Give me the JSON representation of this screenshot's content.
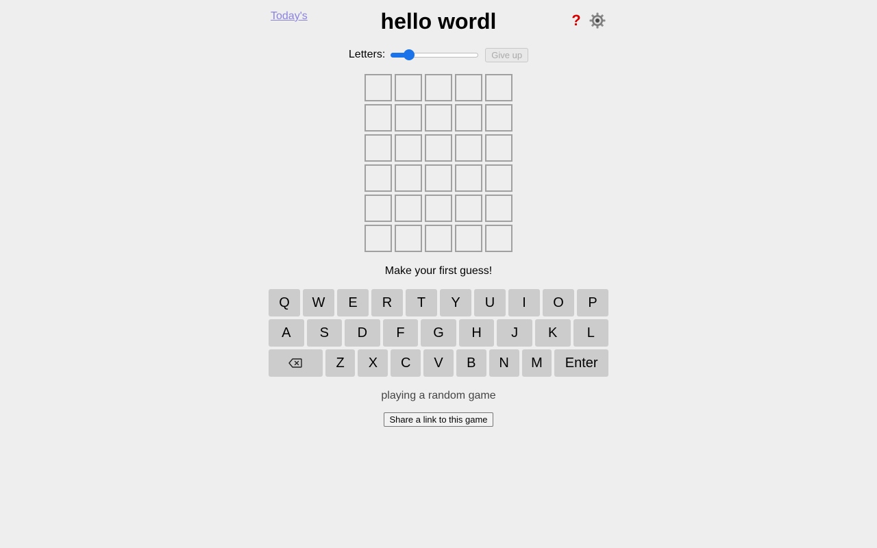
{
  "header": {
    "todays_link": "Today's",
    "title": "hello wordl",
    "help_icon": "question-mark-icon",
    "settings_icon": "gear-icon"
  },
  "settings": {
    "letters_label": "Letters:",
    "letters_slider_fraction": 0.17,
    "give_up_label": "Give up"
  },
  "board": {
    "rows": [
      [
        "",
        "",
        "",
        "",
        ""
      ],
      [
        "",
        "",
        "",
        "",
        ""
      ],
      [
        "",
        "",
        "",
        "",
        ""
      ],
      [
        "",
        "",
        "",
        "",
        ""
      ],
      [
        "",
        "",
        "",
        "",
        ""
      ],
      [
        "",
        "",
        "",
        "",
        ""
      ]
    ]
  },
  "message": "Make your first guess!",
  "keyboard": {
    "row1": [
      "Q",
      "W",
      "E",
      "R",
      "T",
      "Y",
      "U",
      "I",
      "O",
      "P"
    ],
    "row2": [
      "A",
      "S",
      "D",
      "F",
      "G",
      "H",
      "J",
      "K",
      "L"
    ],
    "row3": [
      "Z",
      "X",
      "C",
      "V",
      "B",
      "N",
      "M"
    ],
    "backspace_icon": "backspace-icon",
    "enter_label": "Enter"
  },
  "status": "playing a random game",
  "share_label": "Share a link to this game",
  "colors": {
    "background": "#eeeeee",
    "key": "#cccccc",
    "tile_border": "#a0a0a0",
    "link": "#8a82e0",
    "accent": "#1a73e8",
    "help": "#d40000"
  }
}
